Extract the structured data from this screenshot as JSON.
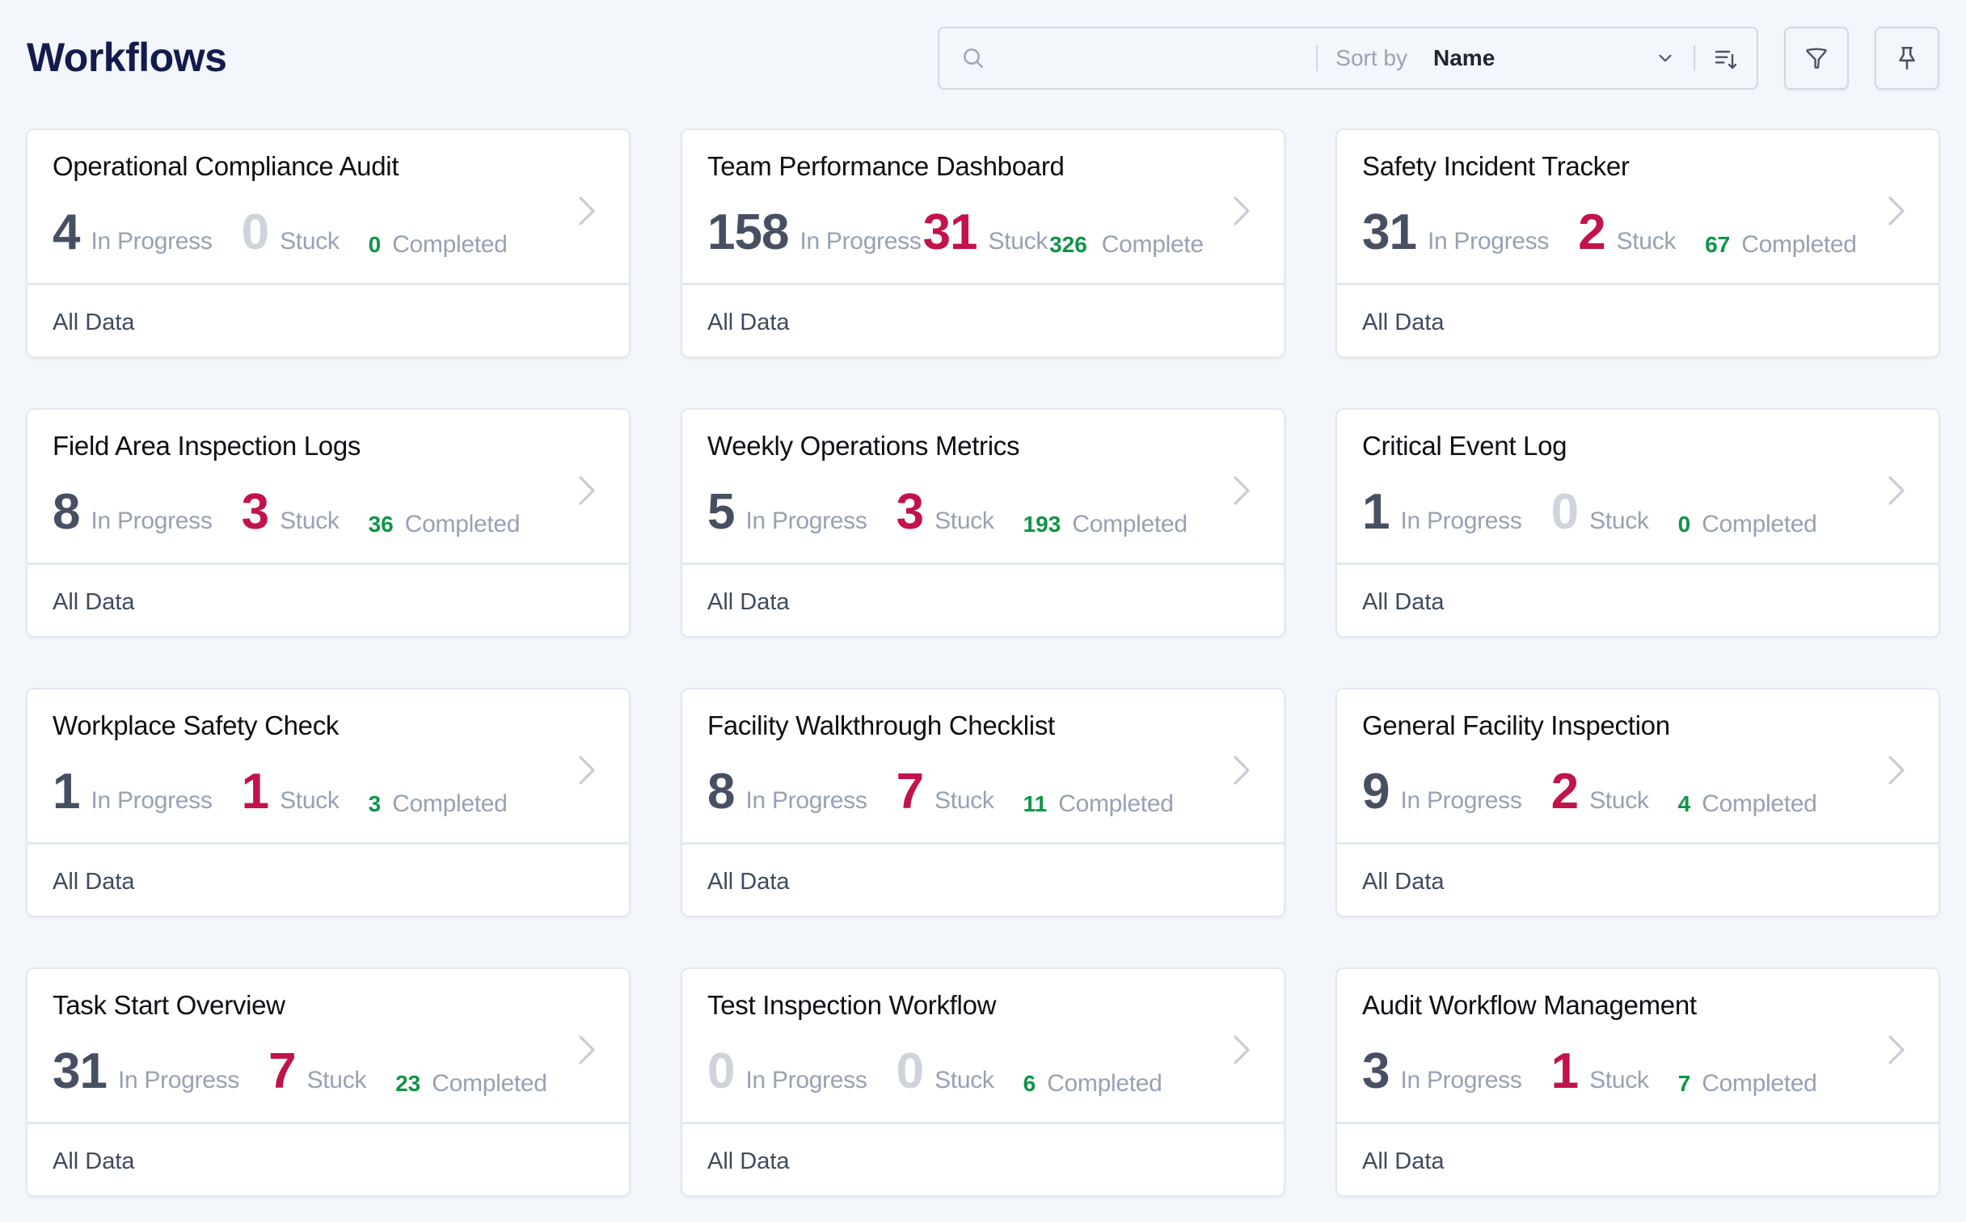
{
  "header": {
    "title": "Workflows"
  },
  "toolbar": {
    "search_placeholder": "",
    "search_value": "",
    "sort_label": "Sort by",
    "sort_value": "Name",
    "icons": {
      "search": "search-icon",
      "sort_dropdown": "chevron-down-icon",
      "sort_order": "sort-descending-icon",
      "filter": "filter-icon",
      "pin": "pin-icon"
    }
  },
  "labels": {
    "in_progress": "In Progress",
    "stuck": "Stuck",
    "completed": "Completed"
  },
  "colors": {
    "in_progress": "#465062",
    "stuck": "#c2134a",
    "completed": "#0f9447",
    "zero": "#ced3dc",
    "title": "#131b4d"
  },
  "workflows": [
    {
      "title": "Operational Compliance Audit",
      "in_progress": 4,
      "stuck": 0,
      "completed": 0,
      "in_progress_label": "In Progress",
      "stuck_label": "Stuck",
      "completed_label": "Completed",
      "footer": "All Data"
    },
    {
      "title": "Team Performance Dashboard",
      "in_progress": 158,
      "stuck": 31,
      "completed": 326,
      "in_progress_label": "In Progress",
      "stuck_label": "Stuck",
      "completed_label": "Complete",
      "footer": "All Data"
    },
    {
      "title": "Safety Incident Tracker",
      "in_progress": 31,
      "stuck": 2,
      "completed": 67,
      "in_progress_label": "In Progress",
      "stuck_label": "Stuck",
      "completed_label": "Completed",
      "footer": "All Data"
    },
    {
      "title": "Field Area Inspection Logs",
      "in_progress": 8,
      "stuck": 3,
      "completed": 36,
      "in_progress_label": "In Progress",
      "stuck_label": "Stuck",
      "completed_label": "Completed",
      "footer": "All Data"
    },
    {
      "title": "Weekly Operations Metrics",
      "in_progress": 5,
      "stuck": 3,
      "completed": 193,
      "in_progress_label": "In Progress",
      "stuck_label": "Stuck",
      "completed_label": "Completed",
      "footer": "All Data"
    },
    {
      "title": "Critical Event Log",
      "in_progress": 1,
      "stuck": 0,
      "completed": 0,
      "in_progress_label": "In Progress",
      "stuck_label": "Stuck",
      "completed_label": "Completed",
      "footer": "All Data"
    },
    {
      "title": "Workplace Safety Check",
      "in_progress": 1,
      "stuck": 1,
      "completed": 3,
      "in_progress_label": "In Progress",
      "stuck_label": "Stuck",
      "completed_label": "Completed",
      "footer": "All Data"
    },
    {
      "title": "Facility Walkthrough Checklist",
      "in_progress": 8,
      "stuck": 7,
      "completed": 11,
      "in_progress_label": "In Progress",
      "stuck_label": "Stuck",
      "completed_label": "Completed",
      "footer": "All Data"
    },
    {
      "title": "General Facility Inspection",
      "in_progress": 9,
      "stuck": 2,
      "completed": 4,
      "in_progress_label": "In Progress",
      "stuck_label": "Stuck",
      "completed_label": "Completed",
      "footer": "All Data"
    },
    {
      "title": "Task Start Overview",
      "in_progress": 31,
      "stuck": 7,
      "completed": 23,
      "in_progress_label": "In Progress",
      "stuck_label": "Stuck",
      "completed_label": "Completed",
      "footer": "All Data"
    },
    {
      "title": "Test Inspection Workflow",
      "in_progress": 0,
      "stuck": 0,
      "completed": 6,
      "in_progress_label": "In Progress",
      "stuck_label": "Stuck",
      "completed_label": "Completed",
      "footer": "All Data"
    },
    {
      "title": "Audit Workflow Management",
      "in_progress": 3,
      "stuck": 1,
      "completed": 7,
      "in_progress_label": "In Progress",
      "stuck_label": "Stuck",
      "completed_label": "Completed",
      "footer": "All Data"
    }
  ]
}
